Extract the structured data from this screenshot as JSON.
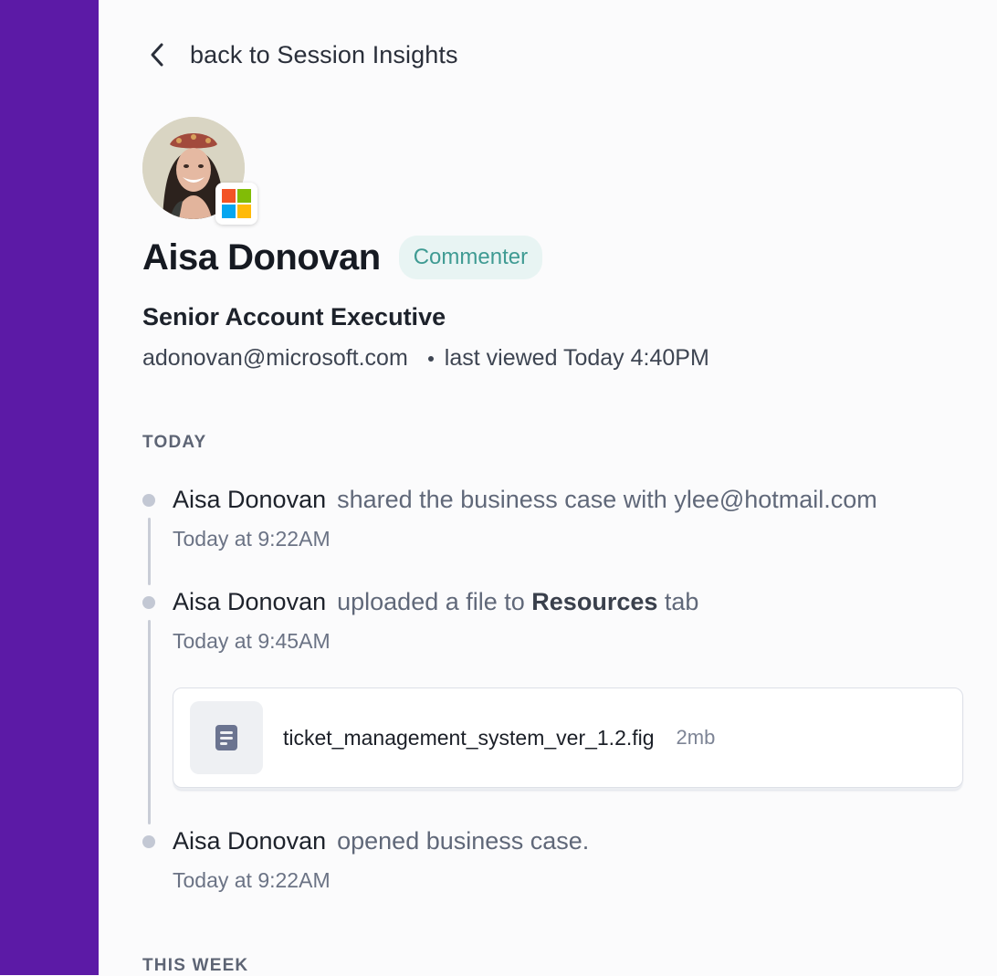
{
  "back_link": {
    "label": "back to Session Insights"
  },
  "profile": {
    "name": "Aisa Donovan",
    "role_badge": "Commenter",
    "job_title": "Senior Account Executive",
    "email": "adonovan@microsoft.com",
    "last_viewed": "last viewed Today 4:40PM",
    "company_logo_icon": "microsoft-logo-icon"
  },
  "sections": {
    "today": {
      "label": "TODAY"
    },
    "this_week": {
      "label": "THIS WEEK"
    }
  },
  "events": [
    {
      "actor": "Aisa Donovan",
      "action": "shared the business case with ylee@hotmail.com",
      "time": "Today at 9:22AM"
    },
    {
      "actor": "Aisa Donovan",
      "action_prefix": "uploaded a file to",
      "action_bold": "Resources",
      "action_suffix": "tab",
      "time": "Today at 9:45AM"
    },
    {
      "actor": "Aisa Donovan",
      "action": "opened business case.",
      "time": "Today at 9:22AM"
    }
  ],
  "attachment": {
    "name": "ticket_management_system_ver_1.2.fig",
    "size": "2mb",
    "icon": "document-icon"
  },
  "colors": {
    "sidebar": "#5c1aa6",
    "badge_bg": "#e8f4f3",
    "badge_text": "#3f9b93",
    "ms_red": "#f35325",
    "ms_green": "#81bc06",
    "ms_blue": "#05a6f0",
    "ms_yellow": "#ffba08"
  }
}
